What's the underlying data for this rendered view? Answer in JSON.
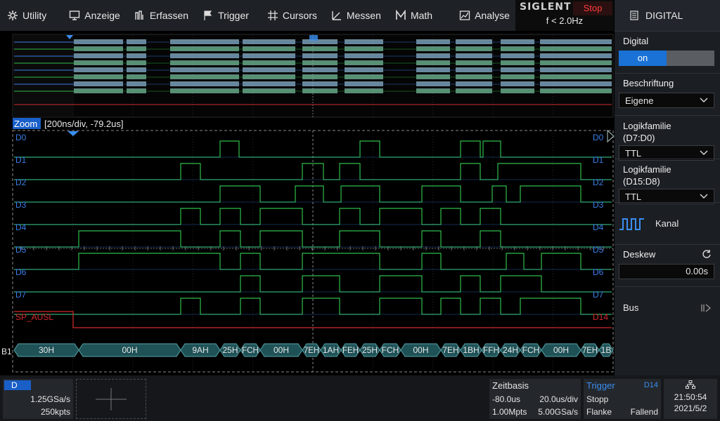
{
  "menu": [
    {
      "label": "Utility",
      "icon": "gear-icon"
    },
    {
      "label": "Anzeige",
      "icon": "monitor-icon"
    },
    {
      "label": "Erfassen",
      "icon": "acquire-icon"
    },
    {
      "label": "Trigger",
      "icon": "flag-icon"
    },
    {
      "label": "Cursors",
      "icon": "crosshair-icon"
    },
    {
      "label": "Messen",
      "icon": "measure-icon"
    },
    {
      "label": "Math",
      "icon": "math-icon"
    },
    {
      "label": "Analyse",
      "icon": "analyse-icon"
    }
  ],
  "brand": {
    "logo": "SIGLENT",
    "run_state": "Stop",
    "frequency": "f < 2.0Hz"
  },
  "panel": {
    "title": "DIGITAL",
    "digital_label": "Digital",
    "digital_state": "on",
    "label_label": "Beschriftung",
    "label_value": "Eigene",
    "logic1_label": "Logikfamilie",
    "logic1_sub": "(D7:D0)",
    "logic1_value": "TTL",
    "logic2_label": "Logikfamilie",
    "logic2_sub": "(D15:D8)",
    "logic2_value": "TTL",
    "channel_label": "Kanal",
    "deskew_label": "Deskew",
    "deskew_value": "0.00s",
    "bus_label": "Bus"
  },
  "zoom": {
    "label": "Zoom",
    "info": "[200ns/div, -79.2us]"
  },
  "channels": [
    "D0",
    "D1",
    "D2",
    "D3",
    "D4",
    "D5",
    "D6",
    "D7"
  ],
  "extra_channel": {
    "left": "SP_AUSL",
    "right": "D14"
  },
  "bus": {
    "name": "B1",
    "values": [
      "30H",
      "00H",
      "9AH",
      "25H",
      "FCH",
      "00H",
      "7EH",
      "1AH",
      "FEH",
      "25H",
      "FCH",
      "00H",
      "7EH",
      "1BH",
      "FFH",
      "24H",
      "FCH",
      "00H",
      "7EH",
      "1B"
    ]
  },
  "bottom": {
    "digital_tag": "D",
    "sample_rate": "1.25GSa/s",
    "points": "250kpts",
    "timebase_title": "Zeitbasis",
    "timebase_delay": "-80.0us",
    "timebase_div": "20.0us/div",
    "timebase_mpts": "1.00Mpts",
    "timebase_rate": "5.00GSa/s",
    "trigger_title": "Trigger",
    "trigger_src": "D14",
    "trigger_state": "Stopp",
    "trigger_type": "Flanke",
    "trigger_edge": "Fallend",
    "time": "21:50:54",
    "date": "2021/5/2"
  },
  "colors": {
    "accent": "#1a72d6",
    "stop": "#ff3b3b",
    "trace_green": "#2fbd4a",
    "trace_blue": "#3a7ee8",
    "trace_red": "#d32b2b",
    "bus": "#4a8f95"
  }
}
